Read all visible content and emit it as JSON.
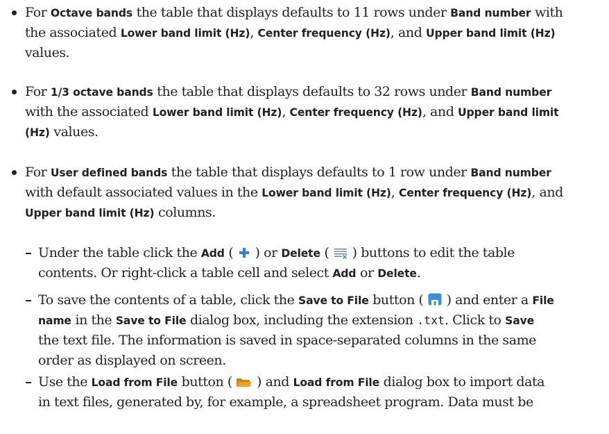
{
  "items": [
    {
      "lines": [
        [
          "For ",
          {
            "b": "Octave bands"
          },
          " the table that displays defaults to 11 rows under ",
          {
            "b": "Band number"
          },
          " with"
        ],
        [
          "the associated ",
          {
            "b": "Lower band limit (Hz)"
          },
          ", ",
          {
            "b": "Center frequency (Hz)"
          },
          ", and ",
          {
            "b": "Upper band limit (Hz)"
          }
        ],
        [
          "values."
        ]
      ]
    },
    {
      "lines": [
        [
          "For ",
          {
            "b": "1/3 octave bands"
          },
          " the table that displays defaults to 32 rows under ",
          {
            "b": "Band number"
          }
        ],
        [
          "with the associated ",
          {
            "b": "Lower band limit (Hz)"
          },
          ", ",
          {
            "b": "Center frequency (Hz)"
          },
          ", and ",
          {
            "b": "Upper band limit"
          }
        ],
        [
          {
            "b": "(Hz)"
          },
          " values."
        ]
      ]
    },
    {
      "lines": [
        [
          "For ",
          {
            "b": "User defined bands"
          },
          " the table that displays defaults to 1 row under ",
          {
            "b": "Band number"
          }
        ],
        [
          "with default associated values in the ",
          {
            "b": "Lower band limit (Hz)"
          },
          ", ",
          {
            "b": "Center frequency (Hz)"
          },
          ", and"
        ],
        [
          {
            "b": "Upper band limit (Hz)"
          },
          " columns."
        ]
      ]
    }
  ],
  "subitems": [
    {
      "lines": [
        [
          "Under the table click the ",
          {
            "b": "Add"
          },
          " ( ",
          {
            "icon": "add-icon"
          },
          " ) or ",
          {
            "b": "Delete"
          },
          " ( ",
          {
            "icon": "delete-icon"
          },
          " ) buttons to edit the table"
        ],
        [
          "contents. Or right-click a table cell and select ",
          {
            "b": "Add"
          },
          " or ",
          {
            "b": "Delete"
          },
          "."
        ]
      ]
    },
    {
      "lines": [
        [
          "To save the contents of a table, click the ",
          {
            "b": "Save to File"
          },
          " button ( ",
          {
            "icon": "save-icon"
          },
          " ) and enter a ",
          {
            "b": "File"
          }
        ],
        [
          {
            "b": "name"
          },
          " in the ",
          {
            "b": "Save to File"
          },
          " dialog box, including the extension ",
          {
            "m": ".txt"
          },
          ". Click to ",
          {
            "b": "Save"
          }
        ],
        [
          "the text file. The information is saved in space-separated columns in the same"
        ],
        [
          "order as displayed on screen."
        ]
      ]
    },
    {
      "lines": [
        [
          "Use the ",
          {
            "b": "Load from File"
          },
          " button ( ",
          {
            "icon": "folder-icon"
          },
          " ) and ",
          {
            "b": "Load from File"
          },
          " dialog box to import data"
        ],
        [
          "in text files, generated by, for example, a spreadsheet program. Data must be"
        ]
      ]
    }
  ],
  "icon_colors": {
    "add": "#2f80d0",
    "delete": "#6b7f93",
    "delete_x": "#3c82c8",
    "save": "#3f8fd8",
    "folder": "#f0a020"
  }
}
